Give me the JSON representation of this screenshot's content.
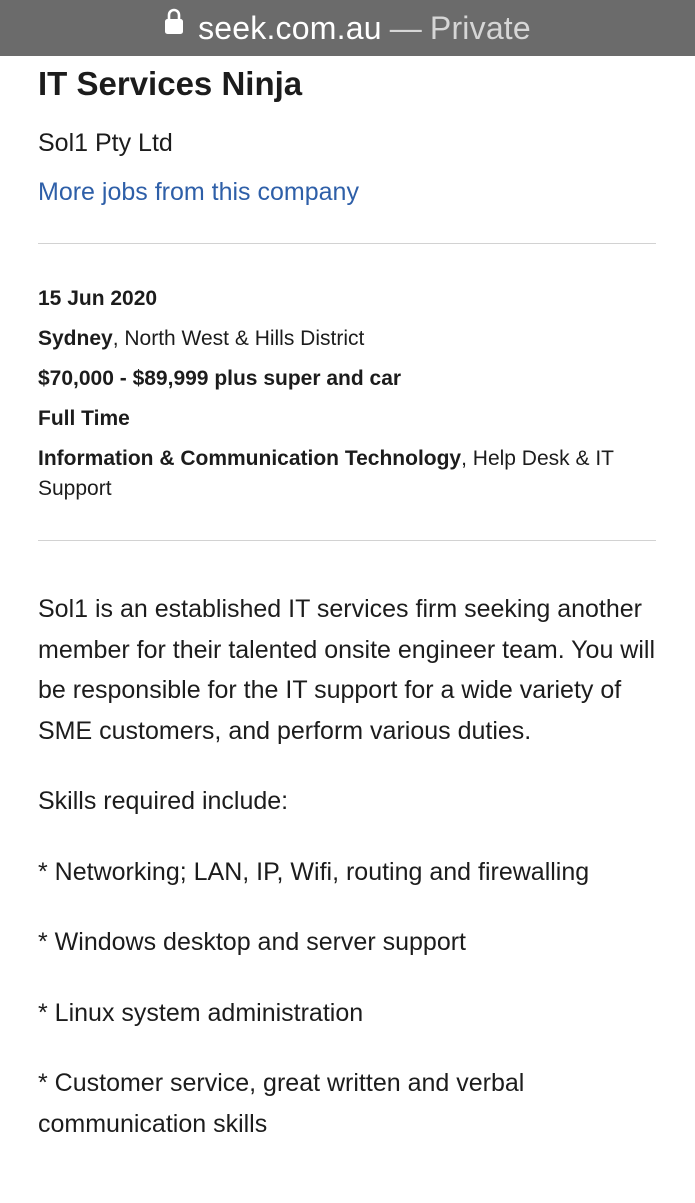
{
  "browser": {
    "domain": "seek.com.au",
    "separator": "—",
    "mode": "Private"
  },
  "job": {
    "title": "IT Services Ninja",
    "company": "Sol1 Pty Ltd",
    "more_jobs_link": "More jobs from this company"
  },
  "meta": {
    "date": "15 Jun 2020",
    "location_city": "Sydney",
    "location_area": ", North West & Hills District",
    "salary": "$70,000 - $89,999 plus super and car",
    "work_type": "Full Time",
    "classification": "Information & Communication Technology",
    "subclassification": ", Help Desk & IT Support"
  },
  "description": {
    "intro": "Sol1 is an established IT services firm seeking another member for their talented onsite engineer team. You will be responsible for the IT support for a wide variety of SME customers, and perform various duties.",
    "skills_heading": "Skills required include:",
    "skills": [
      "* Networking; LAN, IP, Wifi, routing and firewalling",
      "* Windows desktop and server support",
      "* Linux system administration",
      "* Customer service, great written and verbal communication skills"
    ]
  },
  "colors": {
    "link": "#2e5fa8",
    "url_bar": "#6b6b6b",
    "divider": "#d2d2d2"
  },
  "icons": {
    "address_bar": "lock-icon"
  }
}
